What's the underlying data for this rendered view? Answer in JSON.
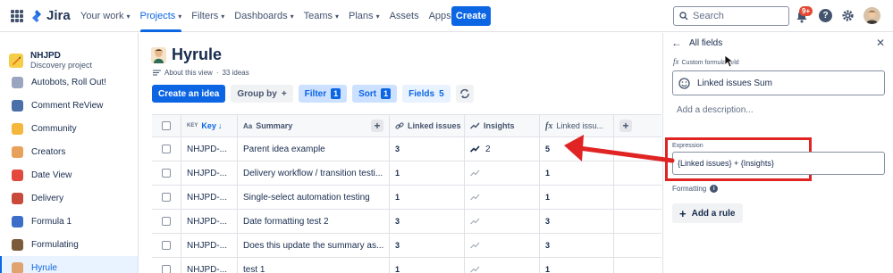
{
  "app": {
    "logo_text": "Jira"
  },
  "topnav": {
    "items": [
      {
        "label": "Your work",
        "chevron": true
      },
      {
        "label": "Projects",
        "chevron": true,
        "active": true
      },
      {
        "label": "Filters",
        "chevron": true
      },
      {
        "label": "Dashboards",
        "chevron": true
      },
      {
        "label": "Teams",
        "chevron": true
      },
      {
        "label": "Plans",
        "chevron": true
      },
      {
        "label": "Assets",
        "chevron": false
      },
      {
        "label": "Apps",
        "chevron": true
      }
    ],
    "create_label": "Create",
    "search_placeholder": "Search",
    "notifications_badge": "9+",
    "help_label": "?"
  },
  "sidebar": {
    "project_name": "NHJPD",
    "project_type": "Discovery project",
    "items": [
      {
        "label": "Autobots, Roll Out!",
        "color": "#9aa6c0"
      },
      {
        "label": "Comment ReView",
        "color": "#4b6fa8"
      },
      {
        "label": "Community",
        "color": "#f5b73b"
      },
      {
        "label": "Creators",
        "color": "#e8a15a"
      },
      {
        "label": "Date View",
        "color": "#e2483d"
      },
      {
        "label": "Delivery",
        "color": "#c94a3a"
      },
      {
        "label": "Formula 1",
        "color": "#3a6ec9"
      },
      {
        "label": "Formulating",
        "color": "#7b5b3a"
      },
      {
        "label": "Hyrule",
        "color": "#e0a36f",
        "active": true
      }
    ]
  },
  "main": {
    "title": "Hyrule",
    "about": "About this view",
    "idea_count": "33 ideas",
    "toolbar": {
      "create_idea": "Create an idea",
      "group_by": "Group by",
      "group_by_plus": "+",
      "filter": "Filter",
      "filter_count": "1",
      "sort": "Sort",
      "sort_count": "1",
      "fields": "Fields",
      "fields_count": "5"
    },
    "columns": {
      "key_prefix": "KEY",
      "key": "Key",
      "summary": "Summary",
      "linked_issues": "Linked issues",
      "insights": "Insights",
      "formula": "Linked issu..."
    },
    "rows": [
      {
        "key": "NHJPD-...",
        "summary": "Parent idea example",
        "linked": "3",
        "insights": "2",
        "formula": "5"
      },
      {
        "key": "NHJPD-...",
        "summary": "Delivery workflow / transition testi...",
        "linked": "1",
        "insights": "",
        "formula": "1"
      },
      {
        "key": "NHJPD-...",
        "summary": "Single-select automation testing",
        "linked": "1",
        "insights": "",
        "formula": "1"
      },
      {
        "key": "NHJPD-...",
        "summary": "Date formatting test 2",
        "linked": "3",
        "insights": "",
        "formula": "3"
      },
      {
        "key": "NHJPD-...",
        "summary": "Does this update the summary as...",
        "linked": "3",
        "insights": "",
        "formula": "3"
      },
      {
        "key": "NHJPD-...",
        "summary": "test 1",
        "linked": "1",
        "insights": "",
        "formula": "1"
      }
    ]
  },
  "panel": {
    "back_label": "All fields",
    "field_type": "Custom formula field",
    "field_name": "Linked issues Sum",
    "description_placeholder": "Add a description...",
    "expression_label": "Expression",
    "expression_value": "{Linked issues} + {Insights}",
    "formatting_label": "Formatting",
    "add_rule": "Add a rule"
  },
  "colors": {
    "accent": "#0c66e4",
    "highlight": "#e02424"
  }
}
